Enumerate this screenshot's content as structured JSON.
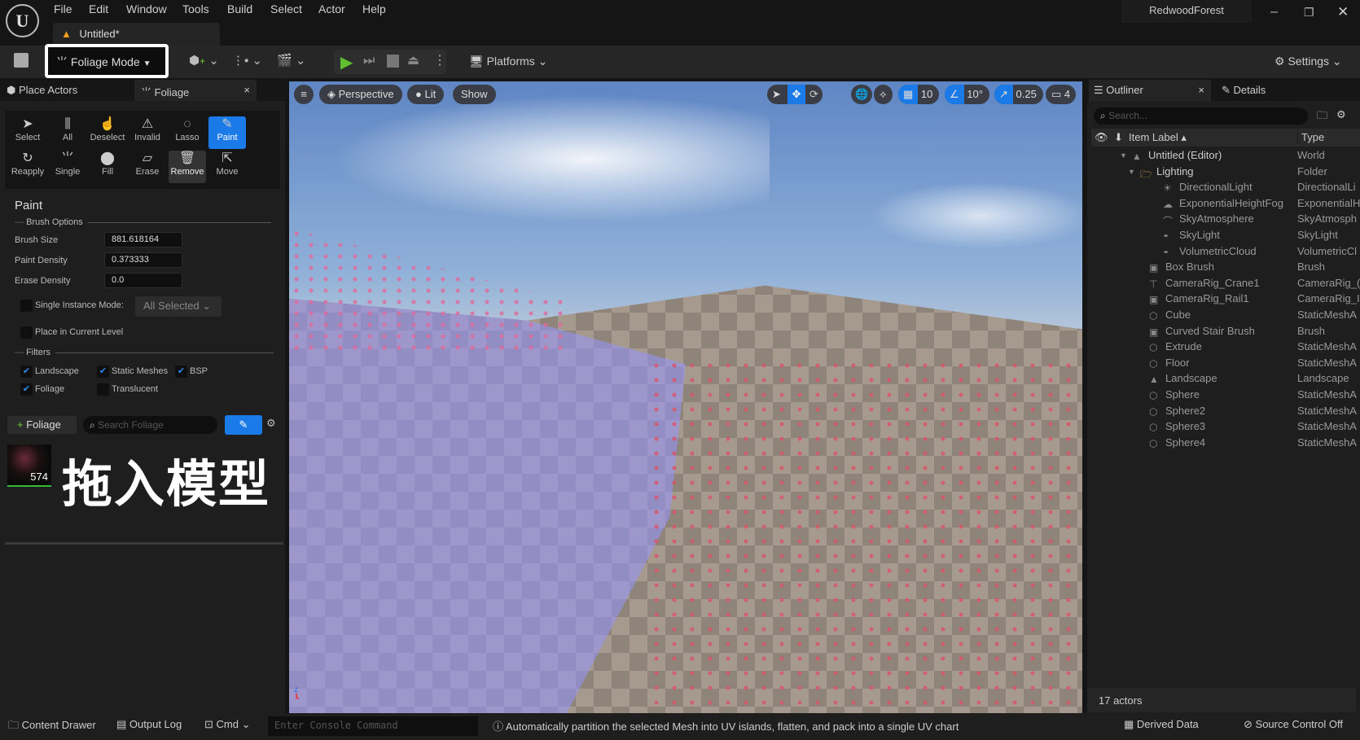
{
  "menu": [
    "File",
    "Edit",
    "Window",
    "Tools",
    "Build",
    "Select",
    "Actor",
    "Help"
  ],
  "doc_tab": "Untitled*",
  "project": "RedwoodForest",
  "toolbar": {
    "mode": "Foliage Mode",
    "platforms": "Platforms",
    "settings": "Settings"
  },
  "left": {
    "tabs": [
      "Place Actors",
      "Foliage"
    ],
    "tools_row1": [
      "Select",
      "All",
      "Deselect",
      "Invalid",
      "Lasso",
      "Paint"
    ],
    "tools_row2": [
      "Reapply",
      "Single",
      "Fill",
      "Erase",
      "Remove",
      "Move"
    ],
    "section": "Paint",
    "brush_options": "Brush Options",
    "brush_size_label": "Brush Size",
    "brush_size": "881.618164",
    "paint_density_label": "Paint Density",
    "paint_density": "0.373333",
    "erase_density_label": "Erase Density",
    "erase_density": "0.0",
    "single_instance_label": "Single Instance Mode:",
    "single_instance_value": "All Selected",
    "place_current_label": "Place in Current Level",
    "filters": "Filters",
    "filter_items": [
      {
        "label": "Landscape",
        "checked": true
      },
      {
        "label": "Static Meshes",
        "checked": true
      },
      {
        "label": "BSP",
        "checked": true
      },
      {
        "label": "Foliage",
        "checked": true
      },
      {
        "label": "Translucent",
        "checked": false
      }
    ],
    "add_foliage": "Foliage",
    "search_placeholder": "Search Foliage",
    "foliage_count": "574",
    "overlay_text": "拖入模型"
  },
  "viewport": {
    "perspective": "Perspective",
    "lit": "Lit",
    "show": "Show",
    "grid": "10",
    "angle": "10°",
    "scale": "0.25",
    "camera_speed": "4"
  },
  "outliner": {
    "tabs": [
      "Outliner",
      "Details"
    ],
    "search_placeholder": "Search...",
    "col_label": "Item Label",
    "col_type": "Type",
    "rows": [
      {
        "name": "Untitled (Editor)",
        "type": "World"
      },
      {
        "name": "Lighting",
        "type": "Folder"
      },
      {
        "name": "DirectionalLight",
        "type": "DirectionalLi"
      },
      {
        "name": "ExponentialHeightFog",
        "type": "ExponentialH"
      },
      {
        "name": "SkyAtmosphere",
        "type": "SkyAtmosph"
      },
      {
        "name": "SkyLight",
        "type": "SkyLight"
      },
      {
        "name": "VolumetricCloud",
        "type": "VolumetricCl"
      },
      {
        "name": "Box Brush",
        "type": "Brush"
      },
      {
        "name": "CameraRig_Crane1",
        "type": "CameraRig_("
      },
      {
        "name": "CameraRig_Rail1",
        "type": "CameraRig_I"
      },
      {
        "name": "Cube",
        "type": "StaticMeshA"
      },
      {
        "name": "Curved Stair Brush",
        "type": "Brush"
      },
      {
        "name": "Extrude",
        "type": "StaticMeshA"
      },
      {
        "name": "Floor",
        "type": "StaticMeshA"
      },
      {
        "name": "Landscape",
        "type": "Landscape"
      },
      {
        "name": "Sphere",
        "type": "StaticMeshA"
      },
      {
        "name": "Sphere2",
        "type": "StaticMeshA"
      },
      {
        "name": "Sphere3",
        "type": "StaticMeshA"
      },
      {
        "name": "Sphere4",
        "type": "StaticMeshA"
      }
    ],
    "count": "17 actors"
  },
  "status": {
    "content_drawer": "Content Drawer",
    "output_log": "Output Log",
    "cmd": "Cmd",
    "console_placeholder": "Enter Console Command",
    "message": "Automatically partition the selected Mesh into UV islands, flatten, and pack into a single UV chart",
    "derived_data": "Derived Data",
    "source_control": "Source Control Off"
  }
}
